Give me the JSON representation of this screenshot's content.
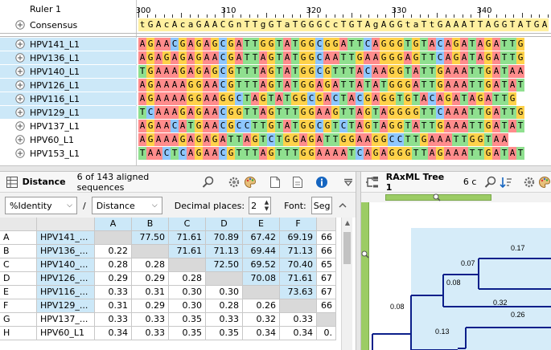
{
  "alignment": {
    "ruler_label": "Ruler 1",
    "consensus_label": "Consensus",
    "ruler_ticks": [
      {
        "label": "300",
        "pos": 300
      },
      {
        "label": "310",
        "pos": 310
      },
      {
        "label": "320",
        "pos": 320
      },
      {
        "label": "330",
        "pos": 330
      },
      {
        "label": "340",
        "pos": 340
      }
    ],
    "consensus": "tGAcAcaGAACGnTTgGTaTGGGCcTGTAgAGGtaTtGAAATTAGGTATGA",
    "sequences": [
      {
        "name": "HPV141_L1",
        "seq": "AGAACGAGAGCGATTGGTATGGCGGATTCAGGGTGTACAGATAGATTG",
        "selected": true
      },
      {
        "name": "HPV136_L1",
        "seq": "AGAGAGAGAACGATTAGTATGGCAATTGAAGGGAGTTCAGATAGATTG",
        "selected": true
      },
      {
        "name": "HPV140_L1",
        "seq": "TGAAAGAGAGCGTTTAGTATGGCGTTTACAAGGTATTGAAATTGATAA",
        "selected": true
      },
      {
        "name": "HPV126_L1",
        "seq": "AGAAAAGGAACGTTTAGTATGGAGATTATATGGGATTGAAATTGATAT",
        "selected": true
      },
      {
        "name": "HPV116_L1",
        "seq": "AGAAAAGGAAGGCTAGTATGGCGACTACGAGGTGTACAGATAGATTG",
        "selected": true
      },
      {
        "name": "HPV129_L1",
        "seq": "TCAAAGAGAACGGTTAGTTTGGAAGTTAGTAGGGGTTCAAATTGATTG",
        "selected": true
      },
      {
        "name": "HPV137_L1",
        "seq": "AGAACATGAACGCCTTGTATGGCGTCTAGTAGGTATTGAAATTGATAT",
        "selected": false
      },
      {
        "name": "HPV60_L1",
        "seq": "AGAAAGAGAGATTAGTCTGGAGATTGGAAGGCCTTGAAATTGGTAA",
        "selected": false
      },
      {
        "name": "HPV153_L1",
        "seq": "TAACTCAGAACGTTTAGTTTGGAAAATCAGAGGGTTAGAAATTGATAT",
        "selected": false
      }
    ]
  },
  "distance": {
    "title": "Distance",
    "count_text": "6 of 143 aligned sequences",
    "metric_select": "%Identity",
    "slash": "/",
    "mode_select": "Distance",
    "decimal_label": "Decimal places:",
    "decimal_value": "2",
    "font_label": "Font:",
    "font_value": "Seg",
    "columns": [
      "A",
      "B",
      "C",
      "D",
      "E",
      "F"
    ],
    "rows": [
      {
        "letter": "A",
        "name": "HPV141_...",
        "values": [
          "",
          "77.50",
          "71.61",
          "70.89",
          "67.42",
          "69.19",
          "66"
        ],
        "selected": true
      },
      {
        "letter": "B",
        "name": "HPV136_...",
        "values": [
          "0.22",
          "",
          "71.61",
          "71.13",
          "69.44",
          "71.13",
          "66"
        ],
        "selected": true
      },
      {
        "letter": "C",
        "name": "HPV140_...",
        "values": [
          "0.28",
          "0.28",
          "",
          "72.50",
          "69.52",
          "70.40",
          "65"
        ],
        "selected": true
      },
      {
        "letter": "D",
        "name": "HPV126_...",
        "values": [
          "0.29",
          "0.29",
          "0.28",
          "",
          "70.08",
          "71.61",
          "67"
        ],
        "selected": true
      },
      {
        "letter": "E",
        "name": "HPV116_...",
        "values": [
          "0.33",
          "0.31",
          "0.30",
          "0.30",
          "",
          "73.63",
          "67"
        ],
        "selected": true
      },
      {
        "letter": "F",
        "name": "HPV129_...",
        "values": [
          "0.31",
          "0.29",
          "0.30",
          "0.28",
          "0.26",
          "",
          "66"
        ],
        "selected": true
      },
      {
        "letter": "G",
        "name": "HPV137_...",
        "values": [
          "0.33",
          "0.33",
          "0.35",
          "0.33",
          "0.32",
          "0.33",
          ""
        ],
        "selected": false
      },
      {
        "letter": "H",
        "name": "HPV60_L1",
        "values": [
          "0.34",
          "0.33",
          "0.35",
          "0.35",
          "0.34",
          "0.34",
          "0."
        ],
        "selected": false
      }
    ]
  },
  "tree": {
    "title": "RAxML Tree 1",
    "tab_suffix": "6 c",
    "labels": [
      "0.17",
      "0.07",
      "0.08",
      "0.32",
      "0.08",
      "0.26",
      "0.13"
    ]
  }
}
